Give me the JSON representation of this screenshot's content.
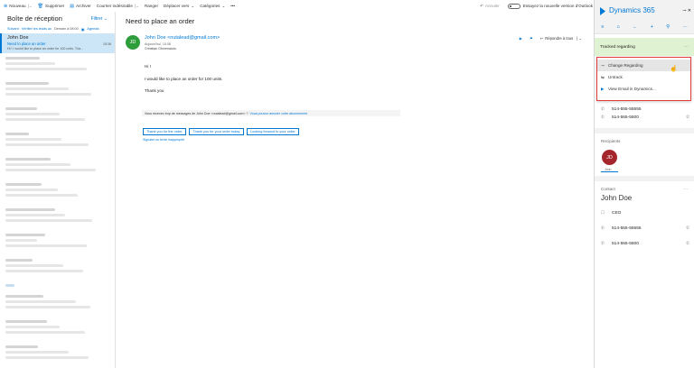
{
  "toolbar": {
    "new": "Nouveau",
    "delete": "Supprimer",
    "archive": "Archiver",
    "junk": "Courrier indésirable",
    "sweep": "Ranger",
    "move": "Déplacer vers",
    "categories": "Catégories",
    "more": "•••",
    "undo": "Annuler",
    "try_new": "Essayez la nouvelle version d'Outlook"
  },
  "list": {
    "title": "Boîte de réception",
    "filter": "Filtrer",
    "sub_next": "Suivant : Vérifier les leads ac",
    "sub_time": "Demain à 08:00",
    "sub_agenda": "Agenda",
    "selected": {
      "from": "John Doe",
      "subject": "Need to place an order",
      "time": "15:38",
      "preview": "Hi ! I would like to place an order for 100 units. Tha..."
    }
  },
  "reading": {
    "subject": "Need to place an order",
    "avatar_initials": "JD",
    "sender": "John Doe <nutalead@gmail.com>",
    "date": "Aujourd'hui, 15:38",
    "to": "Christian Ohmenalutu",
    "reply_all": "Répondre à tous",
    "greeting": "Hi !",
    "line1": "I would like to place an order for 100 units.",
    "thanks": "Thank you",
    "notice": "Vous recevez trop de messages de John Doe <nutalead@gmail.com> ?",
    "notice_link": "Vous pouvez annuler votre abonnement",
    "quick_replies": [
      "Thank you for the order.",
      "Thank you for your order today.",
      "Looking forward to your order."
    ],
    "signature_link": "Signaler un texte inapproprié"
  },
  "dynamics": {
    "title": "Dynamics 365",
    "tracked": "Tracked regarding",
    "tracked_more": "···",
    "menu": [
      "Change Regarding",
      "Untrack",
      "View Email in Dynamics..."
    ],
    "phones_top": [
      "514-555-55555",
      "514-555-5500"
    ],
    "recipients_label": "Recipients",
    "recipient_initials": "JD",
    "recipient_name": "John",
    "contact_label": "Contact",
    "contact_name": "John Doe",
    "contact_title": "CEO",
    "contact_phones": [
      "514-555-55555",
      "514-555-5500"
    ],
    "accent": "#0078d4"
  }
}
